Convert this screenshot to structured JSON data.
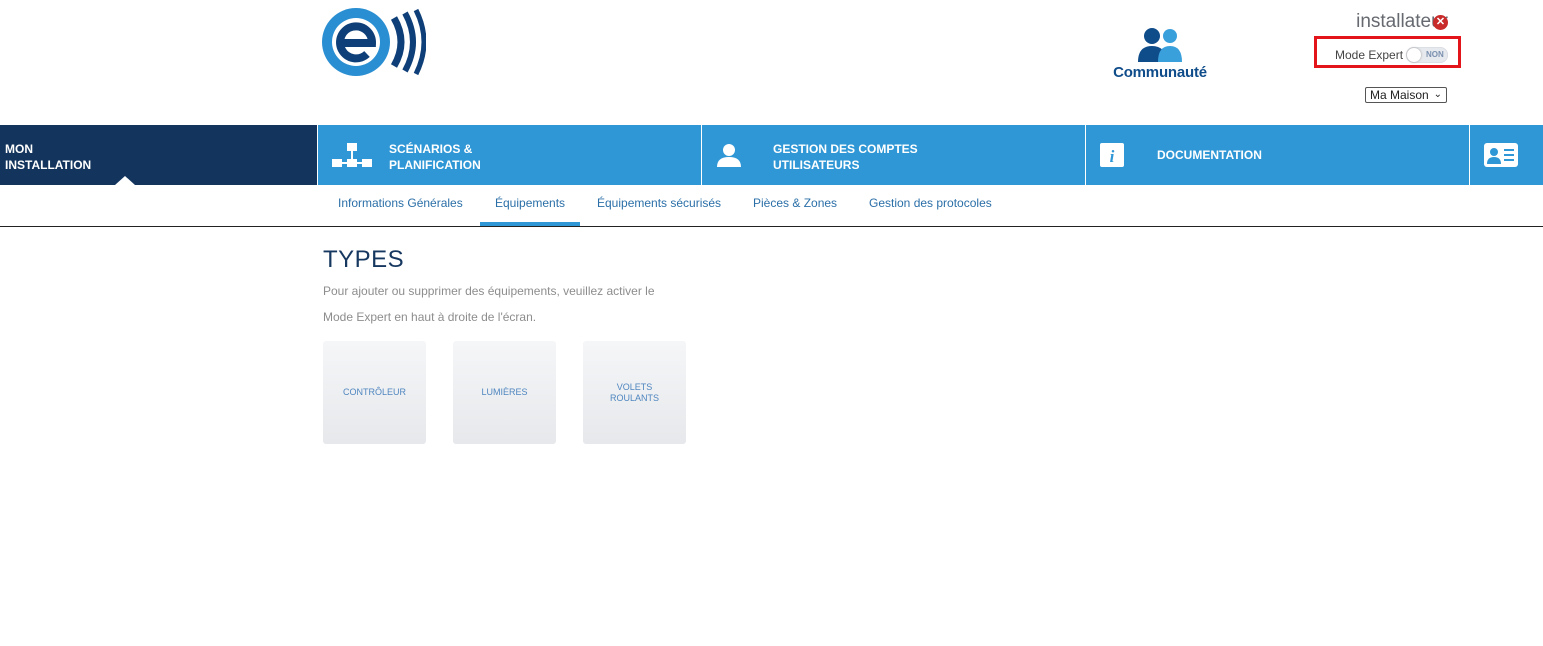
{
  "header": {
    "community_label": "Communauté",
    "user_name": "installateur",
    "mode_expert_label": "Mode Expert",
    "toggle_state": "NON",
    "house_selected": "Ma Maison"
  },
  "nav": {
    "items": [
      {
        "line1": "MON",
        "line2": "INSTALLATION"
      },
      {
        "line1": "SCÉNARIOS &",
        "line2": "PLANIFICATION"
      },
      {
        "line1": "GESTION DES COMPTES",
        "line2": "UTILISATEURS"
      },
      {
        "line1": "DOCUMENTATION"
      }
    ]
  },
  "subnav": {
    "items": [
      "Informations Générales",
      "Équipements",
      "Équipements sécurisés",
      "Pièces & Zones",
      "Gestion des protocoles"
    ]
  },
  "content": {
    "title": "TYPES",
    "desc_line1": "Pour ajouter ou supprimer des équipements, veuillez activer le",
    "desc_line2": "Mode Expert en haut à droite de l'écran.",
    "tiles": [
      "CONTRÔLEUR",
      "LUMIÈRES",
      "VOLETS ROULANTS"
    ]
  },
  "colors": {
    "nav_blue": "#2f97d5",
    "nav_active": "#12345d",
    "highlight_red": "#e3151b"
  },
  "icons": [
    "logo-e",
    "community-users-icon",
    "close-icon",
    "chevron-down-icon",
    "network-icon",
    "user-icon",
    "info-icon",
    "id-card-icon"
  ]
}
